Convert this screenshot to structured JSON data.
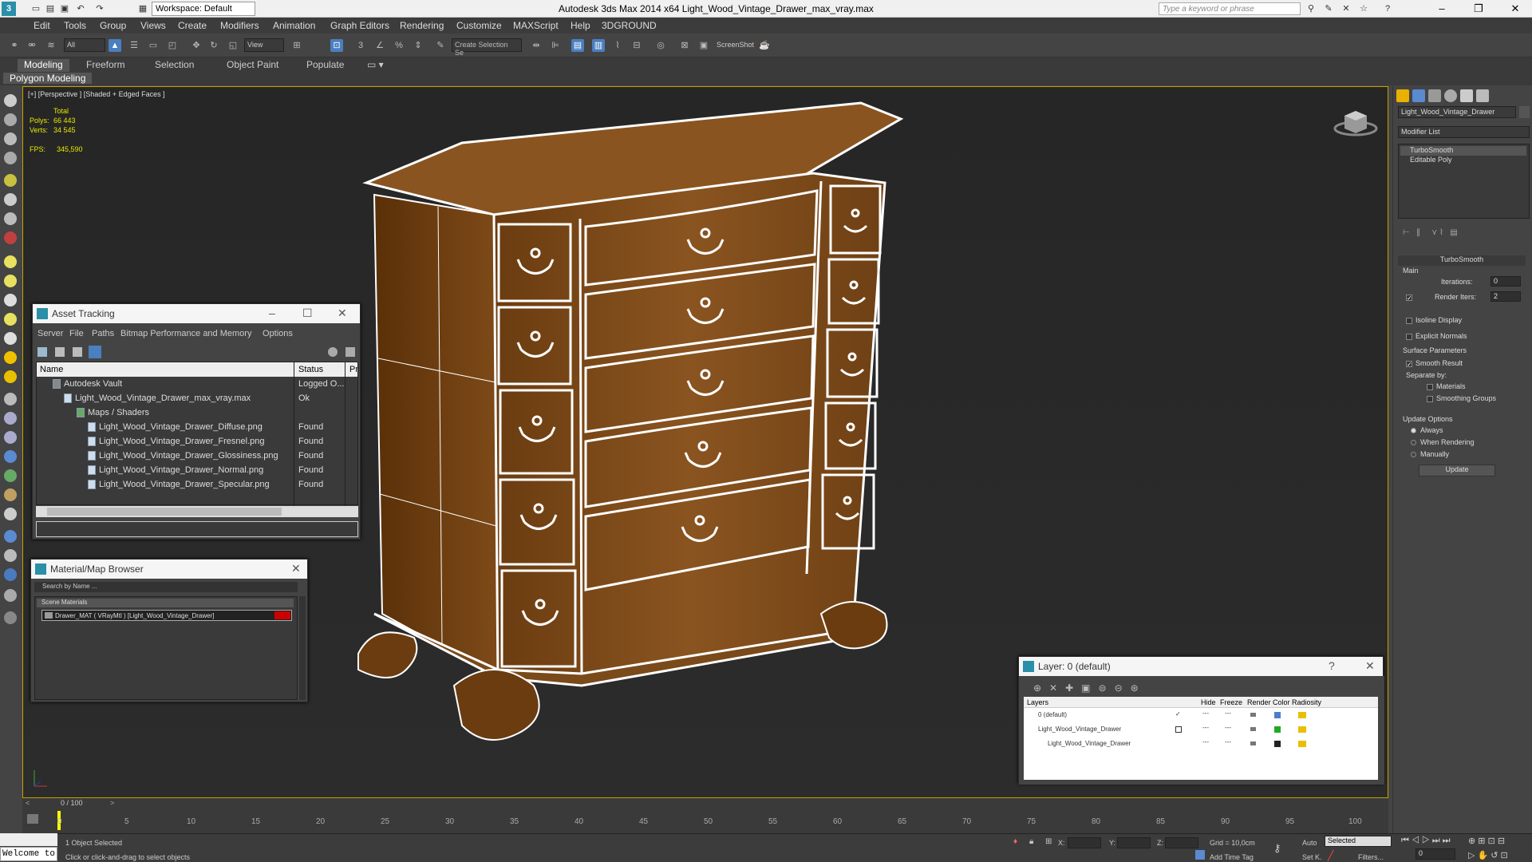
{
  "app": {
    "title": "Autodesk 3ds Max  2014 x64    Light_Wood_Vintage_Drawer_max_vray.max",
    "workspace": "Workspace: Default",
    "search_placeholder": "Type a keyword or phrase",
    "logo_text": "3"
  },
  "menu": [
    "Edit",
    "Tools",
    "Group",
    "Views",
    "Create",
    "Modifiers",
    "Animation",
    "Graph Editors",
    "Rendering",
    "Customize",
    "MAXScript",
    "Help",
    "3DGROUND"
  ],
  "toolbar": {
    "filter": "All",
    "ref_coord": "View",
    "named_sel": "Create Selection Se",
    "screenshot": "ScreenShot"
  },
  "ribbon": {
    "tabs": [
      "Modeling",
      "Freeform",
      "Selection",
      "Object Paint",
      "Populate"
    ],
    "subtab": "Polygon Modeling"
  },
  "viewport": {
    "label": "[+] [Perspective ] [Shaded + Edged Faces ]",
    "stats_total": "Total",
    "polys_label": "Polys:",
    "polys_value": "66 443",
    "verts_label": "Verts:",
    "verts_value": "34 545",
    "fps_label": "FPS:",
    "fps_value": "345,590"
  },
  "command_panel": {
    "object_name": "Light_Wood_Vintage_Drawer",
    "modifier_list": "Modifier List",
    "stack": [
      "TurboSmooth",
      "Editable Poly"
    ],
    "turbosmooth_title": "TurboSmooth",
    "main": "Main",
    "iterations_label": "Iterations:",
    "iterations_value": "0",
    "render_iters_label": "Render Iters:",
    "render_iters_value": "2",
    "isoline": "Isoline Display",
    "explicit_normals": "Explicit Normals",
    "surface_params": "Surface Parameters",
    "smooth_result": "Smooth Result",
    "separate_by": "Separate by:",
    "materials": "Materials",
    "smoothing_groups": "Smoothing Groups",
    "update_options": "Update Options",
    "always": "Always",
    "when_rendering": "When Rendering",
    "manually": "Manually",
    "update_btn": "Update"
  },
  "asset_tracking": {
    "title": "Asset Tracking",
    "menu": [
      "Server",
      "File",
      "Paths",
      "Bitmap Performance and Memory",
      "Options"
    ],
    "col_name": "Name",
    "col_status": "Status",
    "col_pr": "Pr",
    "rows": [
      {
        "name": "Autodesk Vault",
        "status": "Logged O..."
      },
      {
        "name": "Light_Wood_Vintage_Drawer_max_vray.max",
        "status": "Ok"
      },
      {
        "name": "Maps / Shaders",
        "status": ""
      },
      {
        "name": "Light_Wood_Vintage_Drawer_Diffuse.png",
        "status": "Found"
      },
      {
        "name": "Light_Wood_Vintage_Drawer_Fresnel.png",
        "status": "Found"
      },
      {
        "name": "Light_Wood_Vintage_Drawer_Glossiness.png",
        "status": "Found"
      },
      {
        "name": "Light_Wood_Vintage_Drawer_Normal.png",
        "status": "Found"
      },
      {
        "name": "Light_Wood_Vintage_Drawer_Specular.png",
        "status": "Found"
      }
    ]
  },
  "material_browser": {
    "title": "Material/Map Browser",
    "search": "Search by Name ...",
    "section": "Scene Materials",
    "item": "Drawer_MAT  ( VRayMtl ) [Light_Wood_Vintage_Drawer]"
  },
  "layer_panel": {
    "title": "Layer: 0 (default)",
    "col_layers": "Layers",
    "col_hide": "Hide",
    "col_freeze": "Freeze",
    "col_render": "Render",
    "col_color": "Color",
    "col_radiosity": "Radiosity",
    "rows": [
      "0 (default)",
      "Light_Wood_Vintage_Drawer",
      "Light_Wood_Vintage_Drawer"
    ],
    "help": "?"
  },
  "timeline": {
    "frame": "0 / 100",
    "ticks": [
      "0",
      "5",
      "10",
      "15",
      "20",
      "25",
      "30",
      "35",
      "40",
      "45",
      "50",
      "55",
      "60",
      "65",
      "70",
      "75",
      "80",
      "85",
      "90",
      "95",
      "100"
    ]
  },
  "status": {
    "maxscript": "Welcome to",
    "selected": "1 Object Selected",
    "hint": "Click or click-and-drag to select objects",
    "x": "X:",
    "y": "Y:",
    "z": "Z:",
    "grid": "Grid = 10,0cm",
    "auto": "Auto",
    "set_k": "Set K.",
    "selected_drop": "Selected",
    "filters": "Filters...",
    "add_time_tag": "Add Time Tag",
    "frame_field": "0"
  },
  "colors": {
    "wood": "#7a4a1a",
    "wire": "#ffffff",
    "accent": "#2a8fa8",
    "viewport_border": "#c8a000"
  }
}
